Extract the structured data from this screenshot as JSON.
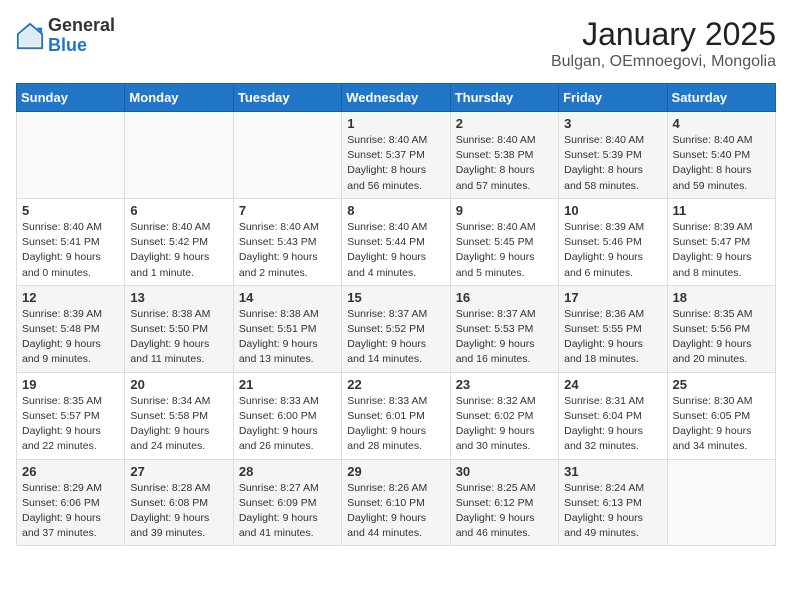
{
  "header": {
    "logo_general": "General",
    "logo_blue": "Blue",
    "month": "January 2025",
    "location": "Bulgan, OEmnoegovi, Mongolia"
  },
  "weekdays": [
    "Sunday",
    "Monday",
    "Tuesday",
    "Wednesday",
    "Thursday",
    "Friday",
    "Saturday"
  ],
  "weeks": [
    [
      {
        "day": "",
        "info": ""
      },
      {
        "day": "",
        "info": ""
      },
      {
        "day": "",
        "info": ""
      },
      {
        "day": "1",
        "info": "Sunrise: 8:40 AM\nSunset: 5:37 PM\nDaylight: 8 hours\nand 56 minutes."
      },
      {
        "day": "2",
        "info": "Sunrise: 8:40 AM\nSunset: 5:38 PM\nDaylight: 8 hours\nand 57 minutes."
      },
      {
        "day": "3",
        "info": "Sunrise: 8:40 AM\nSunset: 5:39 PM\nDaylight: 8 hours\nand 58 minutes."
      },
      {
        "day": "4",
        "info": "Sunrise: 8:40 AM\nSunset: 5:40 PM\nDaylight: 8 hours\nand 59 minutes."
      }
    ],
    [
      {
        "day": "5",
        "info": "Sunrise: 8:40 AM\nSunset: 5:41 PM\nDaylight: 9 hours\nand 0 minutes."
      },
      {
        "day": "6",
        "info": "Sunrise: 8:40 AM\nSunset: 5:42 PM\nDaylight: 9 hours\nand 1 minute."
      },
      {
        "day": "7",
        "info": "Sunrise: 8:40 AM\nSunset: 5:43 PM\nDaylight: 9 hours\nand 2 minutes."
      },
      {
        "day": "8",
        "info": "Sunrise: 8:40 AM\nSunset: 5:44 PM\nDaylight: 9 hours\nand 4 minutes."
      },
      {
        "day": "9",
        "info": "Sunrise: 8:40 AM\nSunset: 5:45 PM\nDaylight: 9 hours\nand 5 minutes."
      },
      {
        "day": "10",
        "info": "Sunrise: 8:39 AM\nSunset: 5:46 PM\nDaylight: 9 hours\nand 6 minutes."
      },
      {
        "day": "11",
        "info": "Sunrise: 8:39 AM\nSunset: 5:47 PM\nDaylight: 9 hours\nand 8 minutes."
      }
    ],
    [
      {
        "day": "12",
        "info": "Sunrise: 8:39 AM\nSunset: 5:48 PM\nDaylight: 9 hours\nand 9 minutes."
      },
      {
        "day": "13",
        "info": "Sunrise: 8:38 AM\nSunset: 5:50 PM\nDaylight: 9 hours\nand 11 minutes."
      },
      {
        "day": "14",
        "info": "Sunrise: 8:38 AM\nSunset: 5:51 PM\nDaylight: 9 hours\nand 13 minutes."
      },
      {
        "day": "15",
        "info": "Sunrise: 8:37 AM\nSunset: 5:52 PM\nDaylight: 9 hours\nand 14 minutes."
      },
      {
        "day": "16",
        "info": "Sunrise: 8:37 AM\nSunset: 5:53 PM\nDaylight: 9 hours\nand 16 minutes."
      },
      {
        "day": "17",
        "info": "Sunrise: 8:36 AM\nSunset: 5:55 PM\nDaylight: 9 hours\nand 18 minutes."
      },
      {
        "day": "18",
        "info": "Sunrise: 8:35 AM\nSunset: 5:56 PM\nDaylight: 9 hours\nand 20 minutes."
      }
    ],
    [
      {
        "day": "19",
        "info": "Sunrise: 8:35 AM\nSunset: 5:57 PM\nDaylight: 9 hours\nand 22 minutes."
      },
      {
        "day": "20",
        "info": "Sunrise: 8:34 AM\nSunset: 5:58 PM\nDaylight: 9 hours\nand 24 minutes."
      },
      {
        "day": "21",
        "info": "Sunrise: 8:33 AM\nSunset: 6:00 PM\nDaylight: 9 hours\nand 26 minutes."
      },
      {
        "day": "22",
        "info": "Sunrise: 8:33 AM\nSunset: 6:01 PM\nDaylight: 9 hours\nand 28 minutes."
      },
      {
        "day": "23",
        "info": "Sunrise: 8:32 AM\nSunset: 6:02 PM\nDaylight: 9 hours\nand 30 minutes."
      },
      {
        "day": "24",
        "info": "Sunrise: 8:31 AM\nSunset: 6:04 PM\nDaylight: 9 hours\nand 32 minutes."
      },
      {
        "day": "25",
        "info": "Sunrise: 8:30 AM\nSunset: 6:05 PM\nDaylight: 9 hours\nand 34 minutes."
      }
    ],
    [
      {
        "day": "26",
        "info": "Sunrise: 8:29 AM\nSunset: 6:06 PM\nDaylight: 9 hours\nand 37 minutes."
      },
      {
        "day": "27",
        "info": "Sunrise: 8:28 AM\nSunset: 6:08 PM\nDaylight: 9 hours\nand 39 minutes."
      },
      {
        "day": "28",
        "info": "Sunrise: 8:27 AM\nSunset: 6:09 PM\nDaylight: 9 hours\nand 41 minutes."
      },
      {
        "day": "29",
        "info": "Sunrise: 8:26 AM\nSunset: 6:10 PM\nDaylight: 9 hours\nand 44 minutes."
      },
      {
        "day": "30",
        "info": "Sunrise: 8:25 AM\nSunset: 6:12 PM\nDaylight: 9 hours\nand 46 minutes."
      },
      {
        "day": "31",
        "info": "Sunrise: 8:24 AM\nSunset: 6:13 PM\nDaylight: 9 hours\nand 49 minutes."
      },
      {
        "day": "",
        "info": ""
      }
    ]
  ]
}
